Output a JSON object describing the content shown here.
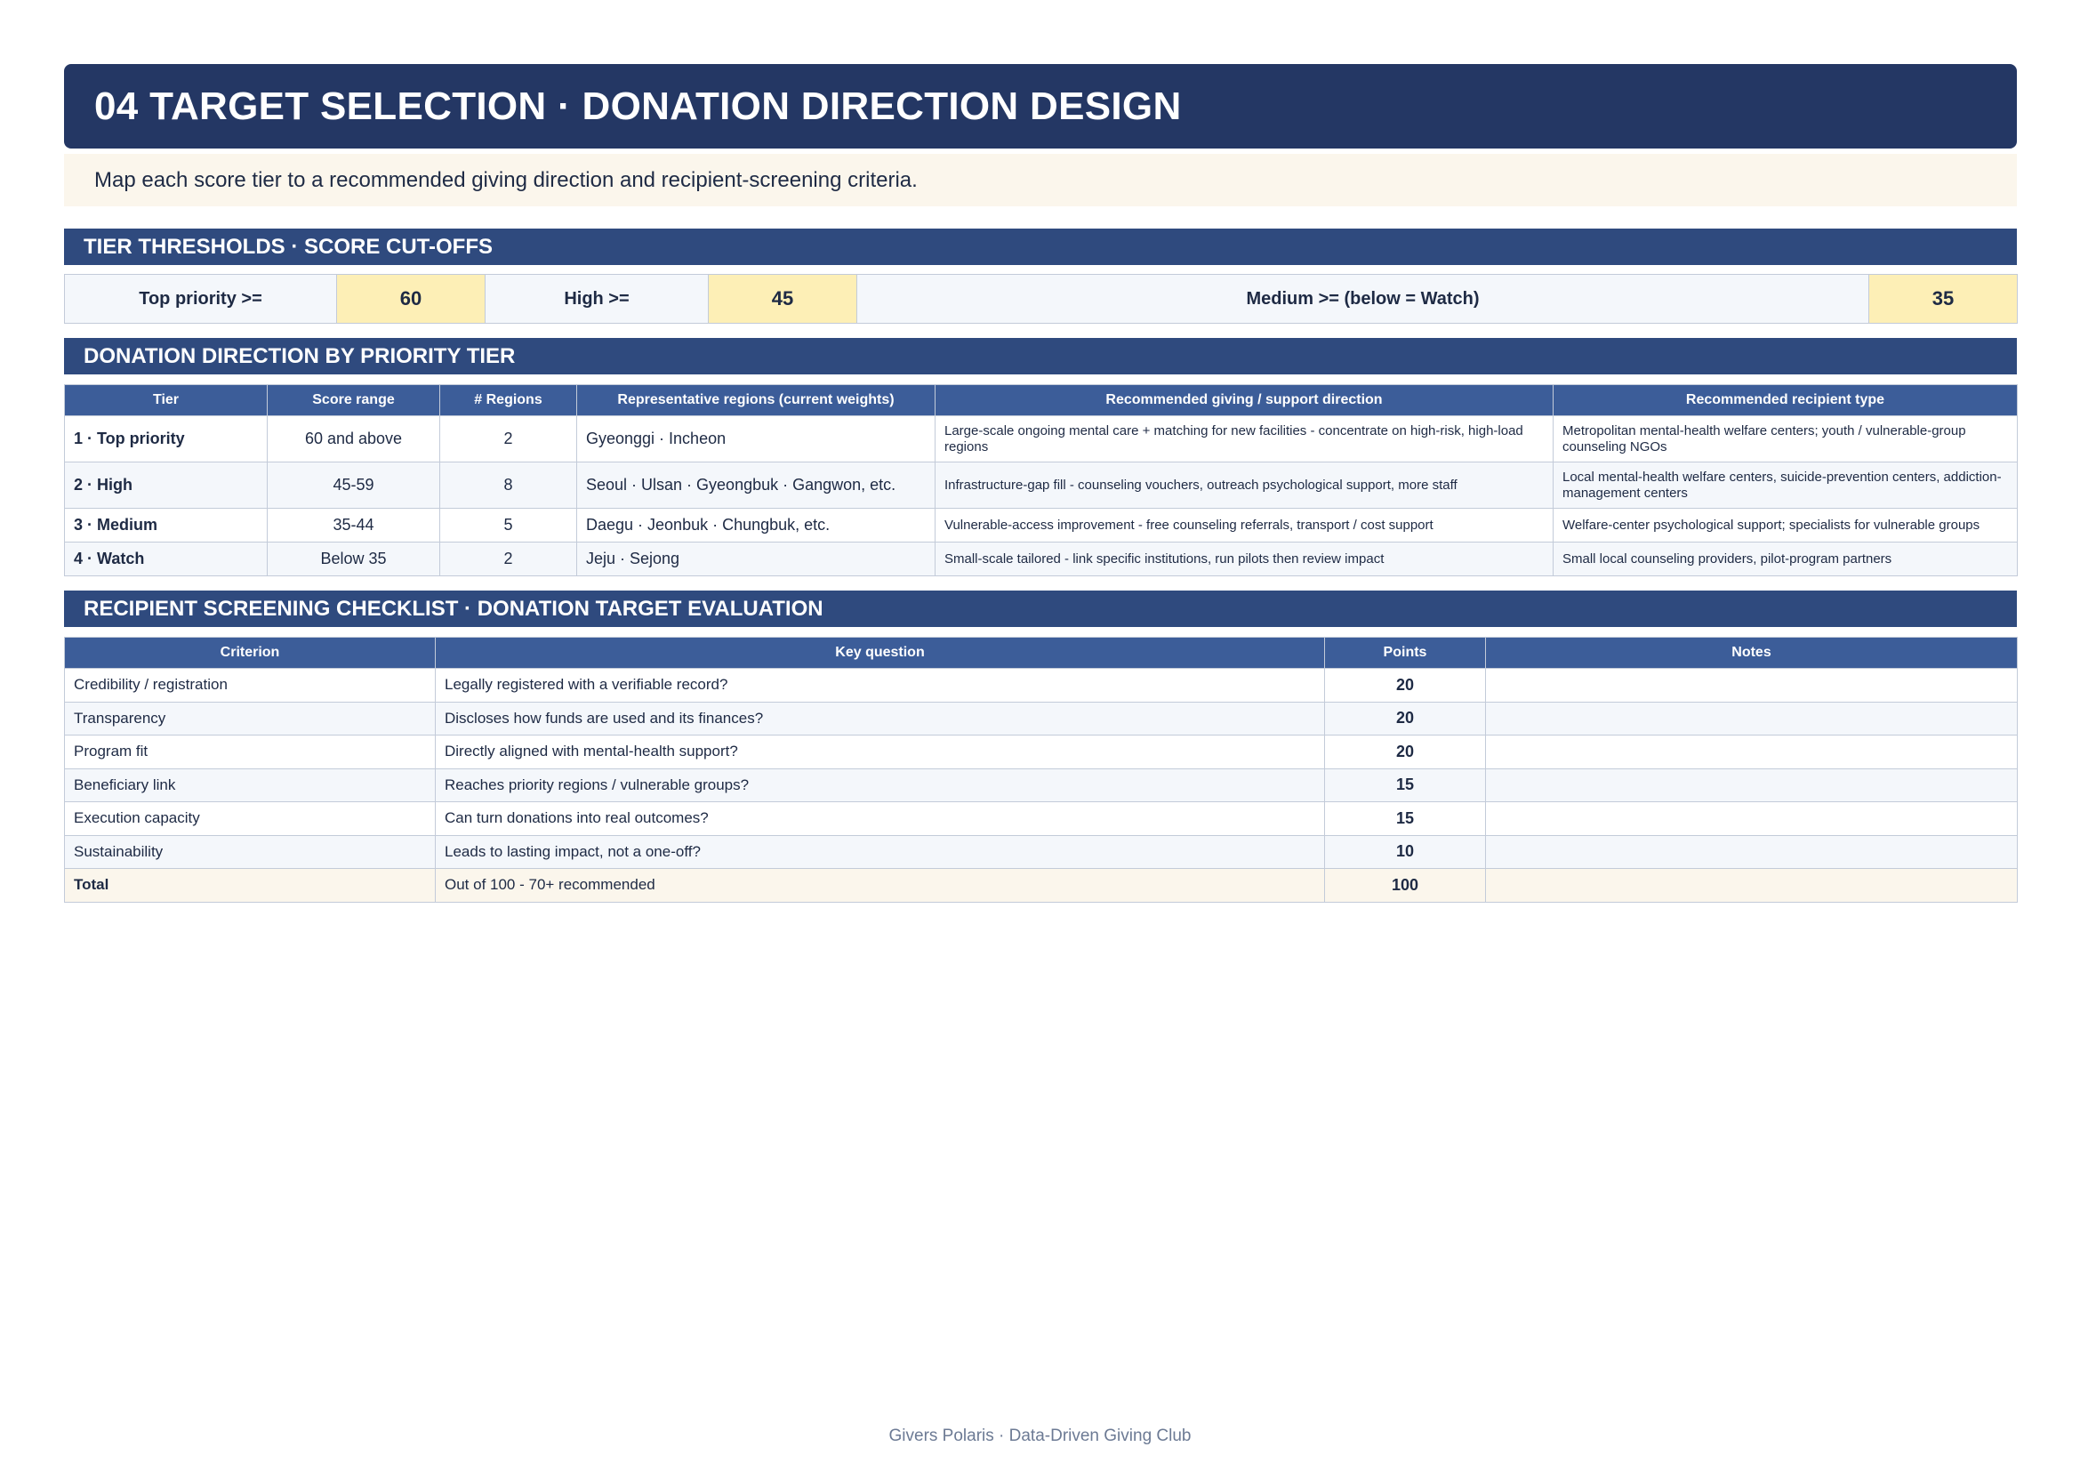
{
  "title": "04 TARGET SELECTION · DONATION DIRECTION DESIGN",
  "subtitle": "Map each score tier to a recommended giving direction and recipient-screening criteria.",
  "thresholds": {
    "heading": "TIER THRESHOLDS · SCORE CUT-OFFS",
    "top_label": "Top priority >=",
    "top_value": "60",
    "high_label": "High >=",
    "high_value": "45",
    "medium_label": "Medium >= (below = Watch)",
    "medium_value": "35"
  },
  "direction": {
    "heading": "DONATION DIRECTION BY PRIORITY TIER",
    "columns": [
      "Tier",
      "Score range",
      "# Regions",
      "Representative regions (current weights)",
      "Recommended giving / support direction",
      "Recommended recipient type"
    ],
    "rows": [
      {
        "tier": "1 · Top priority",
        "range": "60 and above",
        "regions": "2",
        "rep": "Gyeonggi · Incheon",
        "direction": "Large-scale ongoing mental care + matching for new facilities - concentrate on high-risk, high-load regions",
        "recipient": "Metropolitan mental-health welfare centers; youth / vulnerable-group counseling NGOs"
      },
      {
        "tier": "2 · High",
        "range": "45-59",
        "regions": "8",
        "rep": "Seoul · Ulsan · Gyeongbuk · Gangwon, etc.",
        "direction": "Infrastructure-gap fill - counseling vouchers, outreach psychological support, more staff",
        "recipient": "Local mental-health welfare centers, suicide-prevention centers, addiction-management centers"
      },
      {
        "tier": "3 · Medium",
        "range": "35-44",
        "regions": "5",
        "rep": "Daegu · Jeonbuk · Chungbuk, etc.",
        "direction": "Vulnerable-access improvement - free counseling referrals, transport / cost support",
        "recipient": "Welfare-center psychological support; specialists for vulnerable groups"
      },
      {
        "tier": "4 · Watch",
        "range": "Below 35",
        "regions": "2",
        "rep": "Jeju · Sejong",
        "direction": "Small-scale tailored - link specific institutions, run pilots then review impact",
        "recipient": "Small local counseling providers, pilot-program partners"
      }
    ]
  },
  "checklist": {
    "heading": "RECIPIENT SCREENING CHECKLIST · DONATION TARGET EVALUATION",
    "columns": [
      "Criterion",
      "Key question",
      "Points",
      "Notes"
    ],
    "rows": [
      {
        "criterion": "Credibility / registration",
        "question": "Legally registered with a verifiable record?",
        "points": "20",
        "notes": ""
      },
      {
        "criterion": "Transparency",
        "question": "Discloses how funds are used and its finances?",
        "points": "20",
        "notes": ""
      },
      {
        "criterion": "Program fit",
        "question": "Directly aligned with mental-health support?",
        "points": "20",
        "notes": ""
      },
      {
        "criterion": "Beneficiary link",
        "question": "Reaches priority regions / vulnerable groups?",
        "points": "15",
        "notes": ""
      },
      {
        "criterion": "Execution capacity",
        "question": "Can turn donations into real outcomes?",
        "points": "15",
        "notes": ""
      },
      {
        "criterion": "Sustainability",
        "question": "Leads to lasting impact, not a one-off?",
        "points": "10",
        "notes": ""
      }
    ],
    "total": {
      "criterion": "Total",
      "question": "Out of 100 - 70+ recommended",
      "points": "100",
      "notes": ""
    }
  },
  "footer": "Givers Polaris · Data-Driven Giving Club"
}
